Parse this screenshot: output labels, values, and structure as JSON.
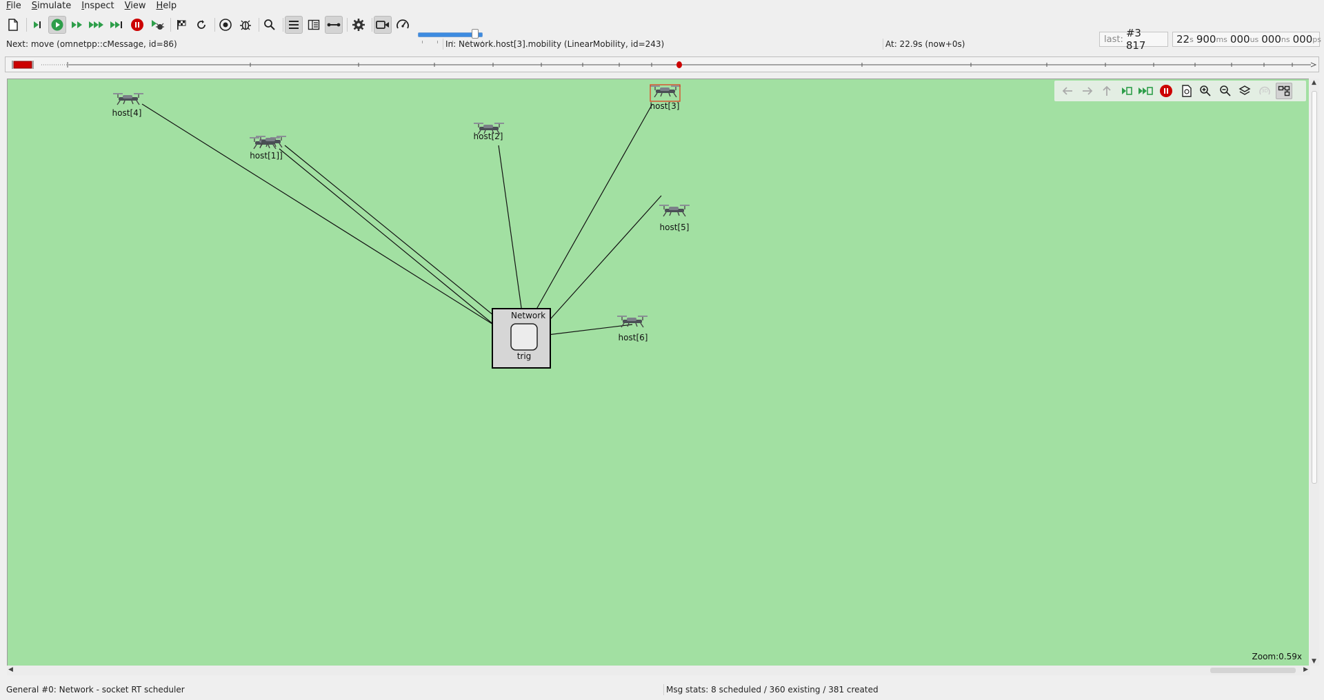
{
  "menu": {
    "items": [
      {
        "key": "F",
        "rest": "ile"
      },
      {
        "key": "S",
        "rest": "imulate"
      },
      {
        "key": "I",
        "rest": "nspect"
      },
      {
        "key": "V",
        "rest": "iew"
      },
      {
        "key": "H",
        "rest": "elp"
      }
    ]
  },
  "toolbar": {
    "icons": [
      "new-file-icon",
      "step-icon",
      "run-icon",
      "fast-run-icon",
      "express-run-icon",
      "run-until-icon",
      "stop-icon",
      "debug-next-icon",
      "finish-flag-icon",
      "rebuild-icon",
      "record-icon",
      "debug-icon",
      "find-icon",
      "timeline-toggle-icon",
      "split-view-icon",
      "link-icon",
      "settings-icon",
      "video-icon",
      "speed-gauge-icon"
    ],
    "speed_value": 0.9
  },
  "event_counter": {
    "label": "last:",
    "value": "#3 817"
  },
  "sim_time": {
    "s": "22",
    "s_unit": "s",
    "ms": "900",
    "ms_unit": "ms",
    "us": "000",
    "us_unit": "us",
    "ns": "000",
    "ns_unit": "ns",
    "ps": "000",
    "ps_unit": "ps"
  },
  "info": {
    "next": "Next: move (omnetpp::cMessage, id=86)",
    "in": "In: Network.host[3].mobility (LinearMobility, id=243)",
    "at": "At: 22.9s (now+0s)"
  },
  "network": {
    "label": "Network",
    "center": {
      "name": "trig"
    },
    "hosts": [
      {
        "name": "host[4]"
      },
      {
        "name": "host[1]]"
      },
      {
        "name": "host[2]"
      },
      {
        "name": "host[3]",
        "selected": true
      },
      {
        "name": "host[5]"
      },
      {
        "name": "host[6]"
      }
    ]
  },
  "zoom": "Zoom:0.59x",
  "status": {
    "config": "General #0: Network - socket RT scheduler",
    "msgstats": "Msg stats: 8 scheduled / 360 existing / 381 created"
  },
  "colors": {
    "canvas_bg": "#a2e0a2",
    "run_green": "#2e9e4a",
    "stop_red": "#cc0000",
    "selection": "#e04020"
  }
}
